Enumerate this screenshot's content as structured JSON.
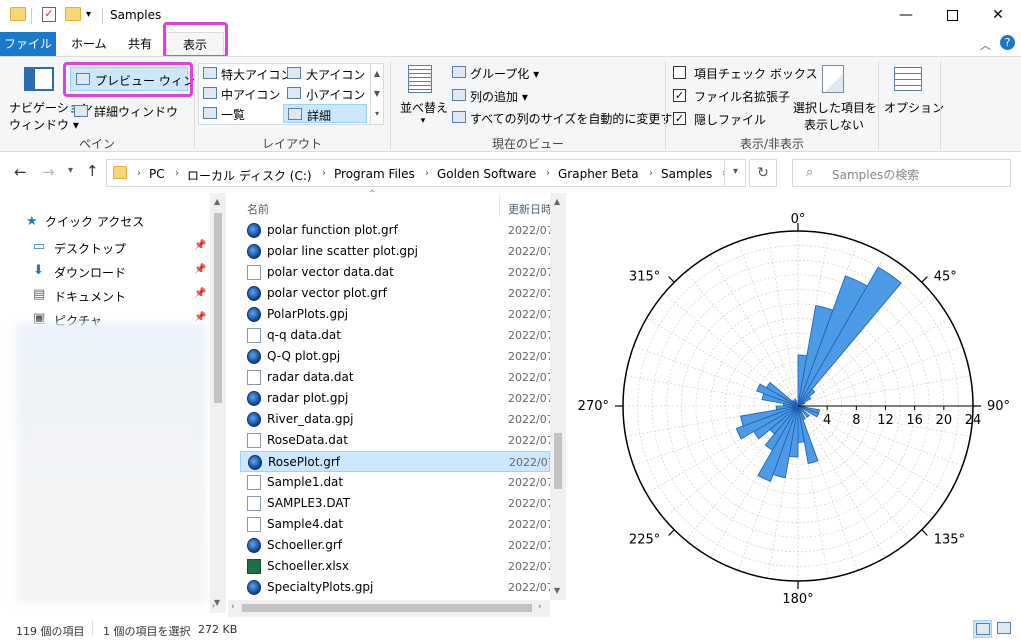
{
  "window": {
    "title": "Samples",
    "minimize_icon": "minimize-icon",
    "maximize_icon": "maximize-icon",
    "close_icon": "close-icon"
  },
  "tabs": {
    "file": "ファイル",
    "home": "ホーム",
    "share": "共有",
    "view": "表示"
  },
  "ribbon": {
    "pane": {
      "nav_pane_line1": "ナビゲーション",
      "nav_pane_line2": "ウィンドウ ▾",
      "preview_pane": "プレビュー ウィンドウ",
      "details_pane": "詳細ウィンドウ",
      "label": "ペイン"
    },
    "layout": {
      "extra_large": "特大アイコン",
      "large": "大アイコン",
      "medium": "中アイコン",
      "small": "小アイコン",
      "list": "一覧",
      "details": "詳細",
      "label": "レイアウト"
    },
    "current_view": {
      "sort_line1": "並べ替え",
      "group_by": "グループ化 ▾",
      "add_column": "列の追加 ▾",
      "fit_columns": "すべての列のサイズを自動的に変更する",
      "label": "現在のビュー"
    },
    "show_hide": {
      "item_checkboxes": "項目チェック ボックス",
      "item_checkboxes_checked": false,
      "file_extensions": "ファイル名拡張子",
      "file_extensions_checked": true,
      "hidden_items": "隠しファイル",
      "hidden_items_checked": true,
      "hide_selected_line1": "選択した項目を",
      "hide_selected_line2": "表示しない",
      "label": "表示/非表示"
    },
    "options": "オプション"
  },
  "address": {
    "crumbs": [
      "PC",
      "ローカル ディスク (C:)",
      "Program Files",
      "Golden Software",
      "Grapher Beta",
      "Samples"
    ],
    "search_placeholder": "Samplesの検索"
  },
  "nav": {
    "quick_access": "クイック アクセス",
    "items": [
      "デスクトップ",
      "ダウンロード",
      "ドキュメント",
      "ピクチャ"
    ]
  },
  "filelist": {
    "col_name": "名前",
    "col_date": "更新日時",
    "files": [
      {
        "name": "polar function plot.grf",
        "date": "2022/07",
        "type": "grf"
      },
      {
        "name": "polar line scatter plot.gpj",
        "date": "2022/07",
        "type": "grf"
      },
      {
        "name": "polar vector data.dat",
        "date": "2022/07",
        "type": "dat"
      },
      {
        "name": "polar vector plot.grf",
        "date": "2022/07",
        "type": "grf"
      },
      {
        "name": "PolarPlots.gpj",
        "date": "2022/07",
        "type": "grf"
      },
      {
        "name": "q-q data.dat",
        "date": "2022/07",
        "type": "dat"
      },
      {
        "name": "Q-Q plot.gpj",
        "date": "2022/07",
        "type": "grf"
      },
      {
        "name": "radar data.dat",
        "date": "2022/07",
        "type": "dat"
      },
      {
        "name": "radar plot.gpj",
        "date": "2022/07",
        "type": "grf"
      },
      {
        "name": "River_data.gpj",
        "date": "2022/07",
        "type": "grf"
      },
      {
        "name": "RoseData.dat",
        "date": "2022/07",
        "type": "dat"
      },
      {
        "name": "RosePlot.grf",
        "date": "2022/07",
        "type": "grf",
        "selected": true
      },
      {
        "name": "Sample1.dat",
        "date": "2022/07",
        "type": "dat"
      },
      {
        "name": "SAMPLE3.DAT",
        "date": "2022/07",
        "type": "dat"
      },
      {
        "name": "Sample4.dat",
        "date": "2022/07",
        "type": "dat"
      },
      {
        "name": "Schoeller.grf",
        "date": "2022/07",
        "type": "grf"
      },
      {
        "name": "Schoeller.xlsx",
        "date": "2022/07",
        "type": "xls"
      },
      {
        "name": "SpecialtyPlots.gpj",
        "date": "2022/07",
        "type": "grf"
      }
    ]
  },
  "preview": {
    "angle_labels": [
      "0°",
      "45°",
      "90°",
      "135°",
      "180°",
      "225°",
      "270°",
      "315°"
    ],
    "radial_labels": [
      "4",
      "8",
      "12",
      "16",
      "20",
      "24"
    ],
    "radial_max": 24,
    "bar_color": "#4d9be6",
    "petals": [
      {
        "from": 0,
        "to": 10,
        "value": 7
      },
      {
        "from": 10,
        "to": 20,
        "value": 14
      },
      {
        "from": 20,
        "to": 30,
        "value": 19
      },
      {
        "from": 30,
        "to": 40,
        "value": 22
      },
      {
        "from": 40,
        "to": 50,
        "value": 3
      },
      {
        "from": 50,
        "to": 60,
        "value": 2
      },
      {
        "from": 60,
        "to": 70,
        "value": 1
      },
      {
        "from": 90,
        "to": 100,
        "value": 1
      },
      {
        "from": 100,
        "to": 110,
        "value": 3
      },
      {
        "from": 110,
        "to": 120,
        "value": 3
      },
      {
        "from": 130,
        "to": 140,
        "value": 2
      },
      {
        "from": 150,
        "to": 160,
        "value": 2
      },
      {
        "from": 160,
        "to": 170,
        "value": 8
      },
      {
        "from": 170,
        "to": 180,
        "value": 5
      },
      {
        "from": 180,
        "to": 190,
        "value": 7
      },
      {
        "from": 190,
        "to": 200,
        "value": 10
      },
      {
        "from": 200,
        "to": 210,
        "value": 11
      },
      {
        "from": 210,
        "to": 220,
        "value": 7
      },
      {
        "from": 220,
        "to": 230,
        "value": 5
      },
      {
        "from": 230,
        "to": 240,
        "value": 7
      },
      {
        "from": 240,
        "to": 250,
        "value": 9
      },
      {
        "from": 250,
        "to": 260,
        "value": 8
      },
      {
        "from": 260,
        "to": 270,
        "value": 3
      },
      {
        "from": 270,
        "to": 280,
        "value": 2
      },
      {
        "from": 280,
        "to": 290,
        "value": 5
      },
      {
        "from": 290,
        "to": 300,
        "value": 6
      },
      {
        "from": 300,
        "to": 310,
        "value": 5
      },
      {
        "from": 310,
        "to": 320,
        "value": 1
      },
      {
        "from": 330,
        "to": 340,
        "value": 1
      }
    ]
  },
  "status": {
    "count": "119 個の項目",
    "selected": "1 個の項目を選択",
    "size": "272 KB"
  },
  "colors": {
    "accent": "#1979ca",
    "highlight": "#e040e0",
    "selected_row": "#cce8ff"
  }
}
